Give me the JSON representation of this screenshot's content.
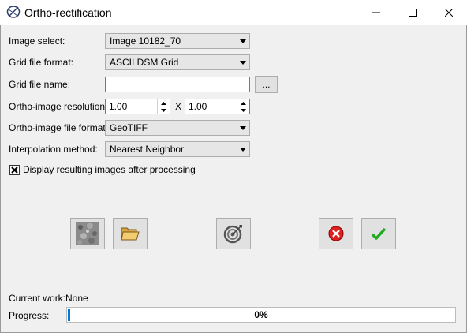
{
  "window": {
    "title": "Ortho-rectification",
    "app_icon": "ortho-app-icon",
    "controls": [
      "minimize-icon",
      "maximize-icon",
      "close-icon"
    ]
  },
  "form": {
    "image_select": {
      "label": "Image select:",
      "value": "Image 10182_70"
    },
    "grid_format": {
      "label": "Grid file format:",
      "value": "ASCII DSM Grid"
    },
    "grid_name": {
      "label": "Grid file name:",
      "value": "",
      "placeholder": "",
      "browse_label": "..."
    },
    "resolution": {
      "label": "Ortho-image resolution:",
      "x_value": "1.00",
      "separator": "X",
      "y_value": "1.00"
    },
    "file_format": {
      "label": "Ortho-image file format:",
      "value": "GeoTIFF"
    },
    "interpolation": {
      "label": "Interpolation method:",
      "value": "Nearest Neighbor"
    },
    "display_results": {
      "label": "Display resulting images after processing",
      "checked": true
    }
  },
  "actions": [
    {
      "name": "dsm-preview-button",
      "icon": "dsm-texture-icon"
    },
    {
      "name": "open-folder-button",
      "icon": "folder-icon"
    },
    {
      "name": "target-button",
      "icon": "target-icon"
    },
    {
      "name": "cancel-button",
      "icon": "cancel-icon"
    },
    {
      "name": "ok-button",
      "icon": "checkmark-icon"
    }
  ],
  "status": {
    "current_work_label": "Current work:",
    "current_work_value": "None",
    "progress_label": "Progress:",
    "progress_fraction": 0.0,
    "progress_text": "0%"
  },
  "colors": {
    "accent": "#0078d7",
    "cancel": "#e02020",
    "ok": "#22aa22"
  }
}
